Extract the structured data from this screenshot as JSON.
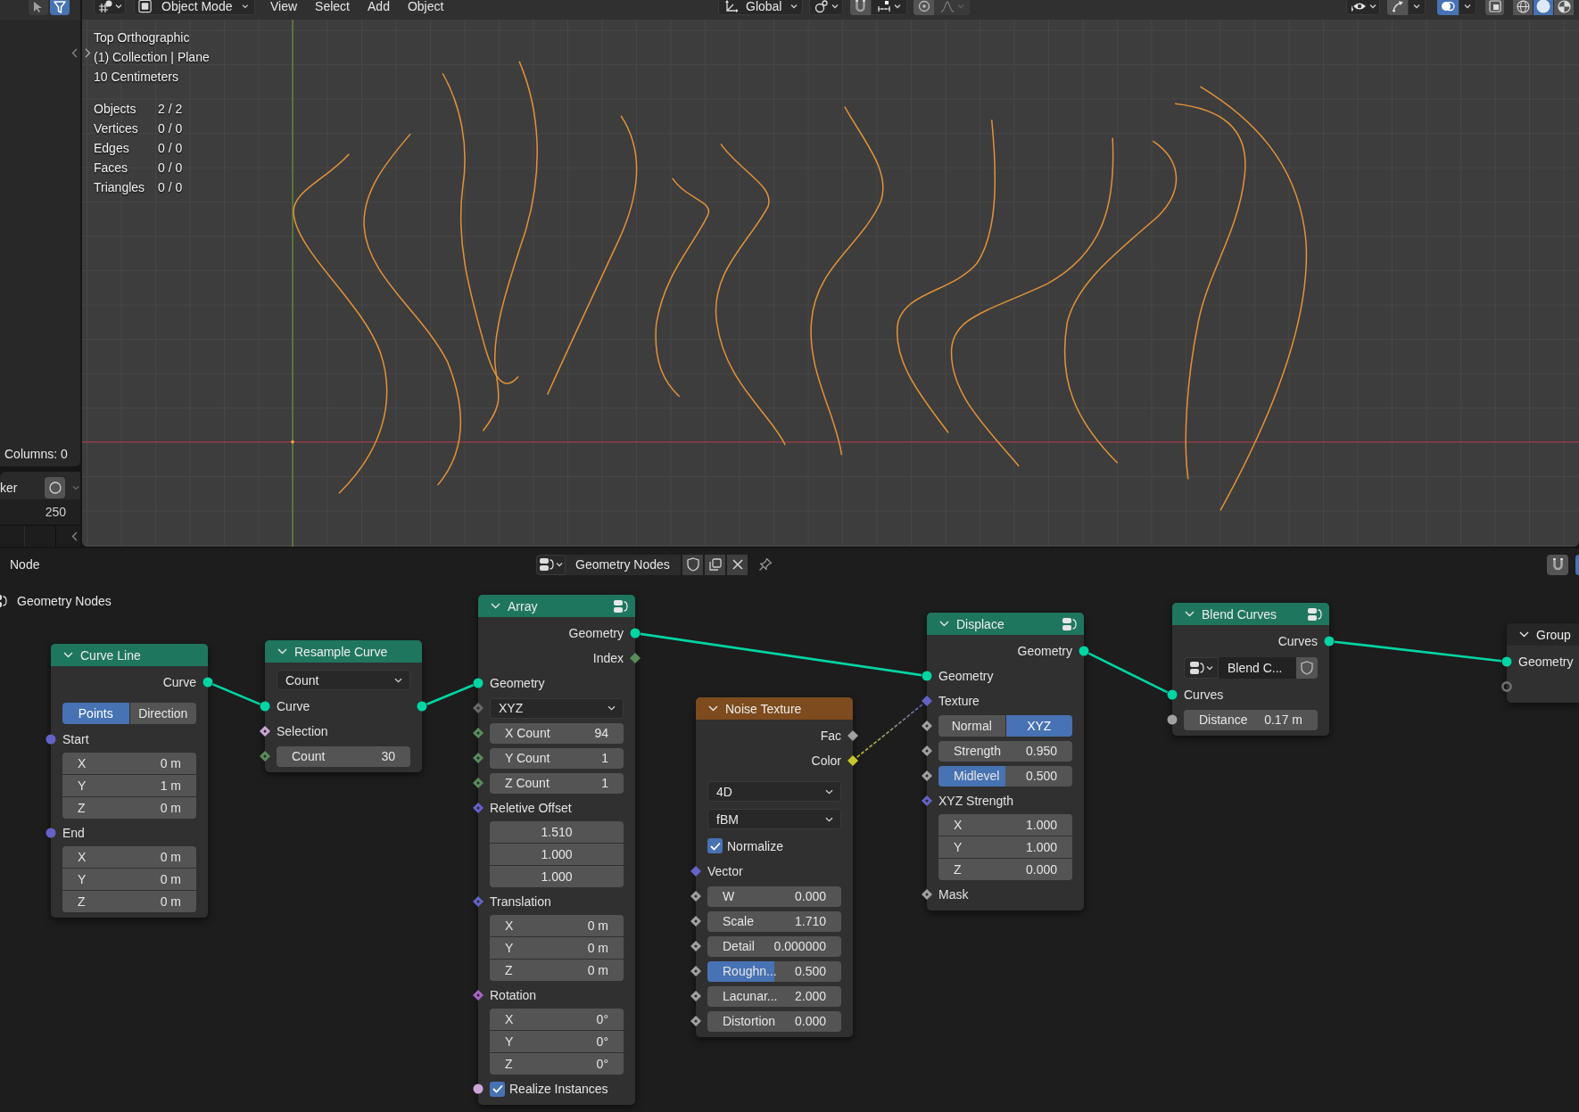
{
  "viewport": {
    "tools": [
      {
        "kind": "cursor",
        "selected": false
      },
      {
        "kind": "funnel",
        "selected": true
      }
    ],
    "header": {
      "mode": "Object Mode",
      "menus": [
        "View",
        "Select",
        "Add",
        "Object"
      ],
      "orientation": "Global",
      "toggles": [
        {
          "kind": "gizmo",
          "on": false
        },
        {
          "kind": "overlay",
          "on": true
        },
        {
          "kind": "xray",
          "on": false
        }
      ],
      "shading": [
        {
          "kind": "wireframe",
          "selected": false
        },
        {
          "kind": "solid",
          "selected": true
        },
        {
          "kind": "material",
          "selected": false
        }
      ]
    },
    "info": [
      "Top Orthographic",
      "(1) Collection | Plane",
      "10 Centimeters"
    ],
    "stats": [
      {
        "label": "Objects",
        "value": "2 / 2"
      },
      {
        "label": "Vertices",
        "value": "0 / 0"
      },
      {
        "label": "Edges",
        "value": "0 / 0"
      },
      {
        "label": "Faces",
        "value": "0 / 0"
      },
      {
        "label": "Triangles",
        "value": "0 / 0"
      }
    ]
  },
  "side_panel": {
    "status": "Columns: 0",
    "label": "ker",
    "value": "250"
  },
  "node_editor": {
    "menu": "Node",
    "node_group": "Geometry Nodes",
    "breadcrumb": "Geometry Nodes",
    "nodes": [
      {
        "title": "Curve Line",
        "kind": "geometry",
        "expanded": true,
        "header_icon": false,
        "rows": [
          {
            "kind": "output",
            "label": "Curve",
            "socket_out": {
              "kind": "circle",
              "color": "#00d6a3",
              "linked": true
            }
          },
          {
            "kind": "toggle",
            "options": [
              {
                "label": "Points",
                "selected": true
              },
              {
                "label": "Direction",
                "selected": false
              }
            ]
          },
          {
            "kind": "input",
            "label": "Start",
            "socket_in": {
              "kind": "circle",
              "color": "#6363c7",
              "linked": false
            }
          },
          {
            "kind": "stack",
            "items": [
              {
                "label": "X",
                "value": "0 m"
              },
              {
                "label": "Y",
                "value": "1 m"
              },
              {
                "label": "Z",
                "value": "0 m"
              }
            ]
          },
          {
            "kind": "input",
            "label": "End",
            "socket_in": {
              "kind": "circle",
              "color": "#6363c7",
              "linked": false
            }
          },
          {
            "kind": "stack",
            "items": [
              {
                "label": "X",
                "value": "0 m"
              },
              {
                "label": "Y",
                "value": "0 m"
              },
              {
                "label": "Z",
                "value": "0 m"
              }
            ]
          }
        ]
      },
      {
        "title": "Resample Curve",
        "kind": "geometry",
        "expanded": true,
        "header_icon": false,
        "rows": [
          {
            "kind": "dropdown",
            "value": "Count"
          },
          {
            "kind": "input",
            "label": "Curve",
            "socket_in": {
              "kind": "circle",
              "color": "#00d6a3",
              "linked": true
            },
            "socket_out": {
              "kind": "circle",
              "color": "#00d6a3",
              "linked": true
            }
          },
          {
            "kind": "input",
            "label": "Selection",
            "socket_in": {
              "kind": "diamond_dot",
              "color": "#cca6d6",
              "linked": false
            }
          },
          {
            "kind": "field",
            "label": "Count",
            "value": "30",
            "socket_in": {
              "kind": "diamond_dot",
              "color": "#598c5c",
              "linked": false
            }
          }
        ]
      },
      {
        "title": "Array",
        "kind": "geometry",
        "expanded": true,
        "header_icon": true,
        "rows": [
          {
            "kind": "output",
            "label": "Geometry",
            "socket_out": {
              "kind": "circle",
              "color": "#00d6a3",
              "linked": true
            }
          },
          {
            "kind": "output",
            "label": "Index",
            "socket_out": {
              "kind": "diamond",
              "color": "#598c5c",
              "linked": false
            }
          },
          {
            "kind": "input",
            "label": "Geometry",
            "socket_in": {
              "kind": "circle",
              "color": "#00d6a3",
              "linked": true
            }
          },
          {
            "kind": "dropdown",
            "value": "XYZ",
            "socket_in": {
              "kind": "diamond_dot",
              "color": "#696969",
              "linked": false
            }
          },
          {
            "kind": "field",
            "label": "X Count",
            "value": "94",
            "socket_in": {
              "kind": "diamond_dot",
              "color": "#598c5c",
              "linked": false
            }
          },
          {
            "kind": "field",
            "label": "Y Count",
            "value": "1",
            "socket_in": {
              "kind": "diamond_dot",
              "color": "#598c5c",
              "linked": false
            }
          },
          {
            "kind": "field",
            "label": "Z Count",
            "value": "1",
            "socket_in": {
              "kind": "diamond_dot",
              "color": "#598c5c",
              "linked": false
            }
          },
          {
            "kind": "input",
            "label": "Reletive Offset",
            "socket_in": {
              "kind": "diamond_dot",
              "color": "#6363c7",
              "linked": false
            }
          },
          {
            "kind": "stack",
            "items": [
              {
                "value": "1.510"
              },
              {
                "value": "1.000"
              },
              {
                "value": "1.000"
              }
            ]
          },
          {
            "kind": "input",
            "label": "Translation",
            "socket_in": {
              "kind": "diamond_dot",
              "color": "#6363c7",
              "linked": false
            }
          },
          {
            "kind": "stack",
            "items": [
              {
                "label": "X",
                "value": "0 m"
              },
              {
                "label": "Y",
                "value": "0 m"
              },
              {
                "label": "Z",
                "value": "0 m"
              }
            ]
          },
          {
            "kind": "input",
            "label": "Rotation",
            "socket_in": {
              "kind": "diamond_dot",
              "color": "#a663c7",
              "linked": false
            }
          },
          {
            "kind": "stack",
            "items": [
              {
                "label": "X",
                "value": "0°"
              },
              {
                "label": "Y",
                "value": "0°"
              },
              {
                "label": "Z",
                "value": "0°"
              }
            ]
          },
          {
            "kind": "checkbox",
            "label": "Realize Instances",
            "checked": true,
            "socket_in": {
              "kind": "circle",
              "color": "#cca6d6",
              "linked": false
            }
          }
        ]
      },
      {
        "title": "Noise Texture",
        "kind": "texture",
        "expanded": true,
        "header_icon": false,
        "rows": [
          {
            "kind": "output",
            "label": "Fac",
            "socket_out": {
              "kind": "diamond",
              "color": "#a1a1a1",
              "linked": false
            }
          },
          {
            "kind": "output",
            "label": "Color",
            "socket_out": {
              "kind": "diamond",
              "color": "#c7c729",
              "linked": true
            }
          },
          {
            "kind": "dropdown",
            "value": "4D"
          },
          {
            "kind": "dropdown",
            "value": "fBM"
          },
          {
            "kind": "checkbox",
            "label": "Normalize",
            "checked": true
          },
          {
            "kind": "input",
            "label": "Vector",
            "socket_in": {
              "kind": "diamond",
              "color": "#6363c7",
              "linked": false
            }
          },
          {
            "kind": "field",
            "label": "W",
            "value": "0.000",
            "socket_in": {
              "kind": "diamond_dot",
              "color": "#a1a1a1",
              "linked": false
            }
          },
          {
            "kind": "field",
            "label": "Scale",
            "value": "1.710",
            "socket_in": {
              "kind": "diamond_dot",
              "color": "#a1a1a1",
              "linked": false
            }
          },
          {
            "kind": "field",
            "label": "Detail",
            "value": "0.000000",
            "socket_in": {
              "kind": "diamond_dot",
              "color": "#a1a1a1",
              "linked": false
            }
          },
          {
            "kind": "field",
            "label": "Roughn...",
            "value": "0.500",
            "level": 0.5,
            "socket_in": {
              "kind": "diamond_dot",
              "color": "#a1a1a1",
              "linked": false
            }
          },
          {
            "kind": "field",
            "label": "Lacunar...",
            "value": "2.000",
            "socket_in": {
              "kind": "diamond_dot",
              "color": "#a1a1a1",
              "linked": false
            }
          },
          {
            "kind": "field",
            "label": "Distortion",
            "value": "0.000",
            "socket_in": {
              "kind": "diamond_dot",
              "color": "#a1a1a1",
              "linked": false
            }
          }
        ]
      },
      {
        "title": "Displace",
        "kind": "geometry",
        "expanded": true,
        "header_icon": true,
        "rows": [
          {
            "kind": "output",
            "label": "Geometry",
            "socket_out": {
              "kind": "circle",
              "color": "#00d6a3",
              "linked": true
            }
          },
          {
            "kind": "input",
            "label": "Geometry",
            "socket_in": {
              "kind": "circle",
              "color": "#00d6a3",
              "linked": true
            }
          },
          {
            "kind": "input",
            "label": "Texture",
            "socket_in": {
              "kind": "diamond",
              "color": "#6363c7",
              "linked": true
            }
          },
          {
            "kind": "toggle",
            "options": [
              {
                "label": "Normal",
                "selected": false
              },
              {
                "label": "XYZ",
                "selected": true
              }
            ],
            "socket_in": {
              "kind": "diamond_dot",
              "color": "#a1a1a1",
              "linked": false
            }
          },
          {
            "kind": "field",
            "label": "Strength",
            "value": "0.950",
            "socket_in": {
              "kind": "diamond_dot",
              "color": "#a1a1a1",
              "linked": false
            }
          },
          {
            "kind": "field",
            "label": "Midlevel",
            "value": "0.500",
            "level": 0.5,
            "socket_in": {
              "kind": "diamond_dot",
              "color": "#a1a1a1",
              "linked": false
            }
          },
          {
            "kind": "input",
            "label": "XYZ Strength",
            "socket_in": {
              "kind": "diamond_dot",
              "color": "#6363c7",
              "linked": false
            }
          },
          {
            "kind": "stack",
            "items": [
              {
                "label": "X",
                "value": "1.000"
              },
              {
                "label": "Y",
                "value": "1.000"
              },
              {
                "label": "Z",
                "value": "0.000"
              }
            ]
          },
          {
            "kind": "input",
            "label": "Mask",
            "socket_in": {
              "kind": "diamond_dot",
              "color": "#a1a1a1",
              "linked": false
            }
          }
        ]
      },
      {
        "title": "Blend Curves",
        "kind": "geometry",
        "expanded": true,
        "header_icon": true,
        "rows": [
          {
            "kind": "output",
            "label": "Curves",
            "socket_out": {
              "kind": "circle",
              "color": "#00d6a3",
              "linked": true
            }
          },
          {
            "kind": "datablock",
            "value": "Blend C..."
          },
          {
            "kind": "input",
            "label": "Curves",
            "socket_in": {
              "kind": "circle",
              "color": "#00d6a3",
              "linked": true
            }
          },
          {
            "kind": "field",
            "label": "Distance",
            "value": "0.17 m",
            "socket_in": {
              "kind": "circle",
              "color": "#a1a1a1",
              "linked": false
            }
          }
        ]
      },
      {
        "title": "Group",
        "kind": "output",
        "expanded": true,
        "header_icon": false,
        "rows": [
          {
            "kind": "input",
            "label": "Geometry",
            "socket_in": {
              "kind": "circle",
              "color": "#00d6a3",
              "linked": true
            }
          },
          {
            "kind": "input",
            "socket_in": {
              "kind": "hollow",
              "color": "#6e6e6e",
              "linked": false
            }
          }
        ]
      }
    ]
  }
}
